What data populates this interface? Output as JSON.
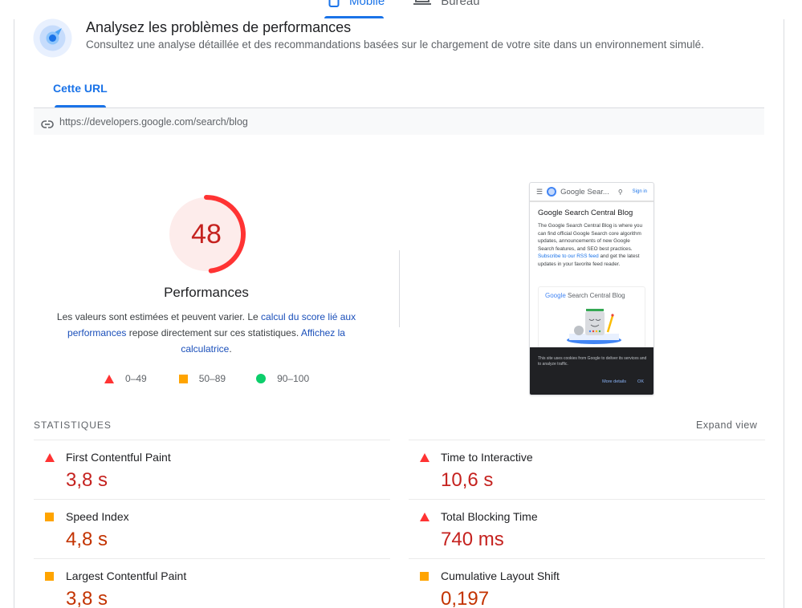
{
  "device_tabs": [
    {
      "label": "Mobile",
      "icon": "smartphone-icon",
      "active": true
    },
    {
      "label": "Bureau",
      "icon": "laptop-icon",
      "active": false
    }
  ],
  "header": {
    "icon": "speed-gauge-icon",
    "title": "Analysez les problèmes de performances",
    "subtitle": "Consultez une analyse détaillée et des recommandations basées sur le chargement de votre site dans un environnement simulé."
  },
  "url_tab": {
    "label": "Cette URL",
    "url": "https://developers.google.com/search/blog",
    "icon": "link-icon"
  },
  "score": {
    "value": "48",
    "fraction": 0.48,
    "label": "Performances",
    "color": "#ff3333",
    "desc_prefix": "Les valeurs sont estimées et peuvent varier. Le ",
    "desc_link1": "calcul du score lié aux performances",
    "desc_middle": " repose directement sur ces statistiques. ",
    "desc_link2": "Affichez la calculatrice",
    "desc_suffix": "."
  },
  "legend": [
    {
      "shape": "triangle",
      "range": "0–49",
      "color": "#ff3333"
    },
    {
      "shape": "square",
      "range": "50–89",
      "color": "#ffa400"
    },
    {
      "shape": "circle",
      "range": "90–100",
      "color": "#0cce6b"
    }
  ],
  "thumbnail": {
    "brand": "Google Sear...",
    "signin": "Sign in",
    "heading": "Google Search Central Blog",
    "paragraph": "The Google Search Central Blog is where you can find official Google Search core algorithm updates, announcements of new Google Search features, and SEO best practices. ",
    "paragraph_link": "Subscribe to our RSS feed",
    "paragraph_end": " and get the latest updates in your favorite feed reader.",
    "card_google": "Google",
    "card_title": " Search Central Blog",
    "cookie_text": "This site uses cookies from Google to deliver its services and to analyze traffic.",
    "cookie_more": "More details",
    "cookie_ok": "OK"
  },
  "statistics": {
    "heading": "STATISTIQUES",
    "expand_label": "Expand view",
    "left": [
      {
        "name": "First Contentful Paint",
        "value": "3,8 s",
        "rating": "fail"
      },
      {
        "name": "Speed Index",
        "value": "4,8 s",
        "rating": "average"
      },
      {
        "name": "Largest Contentful Paint",
        "value": "3,8 s",
        "rating": "average"
      }
    ],
    "right": [
      {
        "name": "Time to Interactive",
        "value": "10,6 s",
        "rating": "fail"
      },
      {
        "name": "Total Blocking Time",
        "value": "740 ms",
        "rating": "fail"
      },
      {
        "name": "Cumulative Layout Shift",
        "value": "0,197",
        "rating": "average"
      }
    ]
  }
}
